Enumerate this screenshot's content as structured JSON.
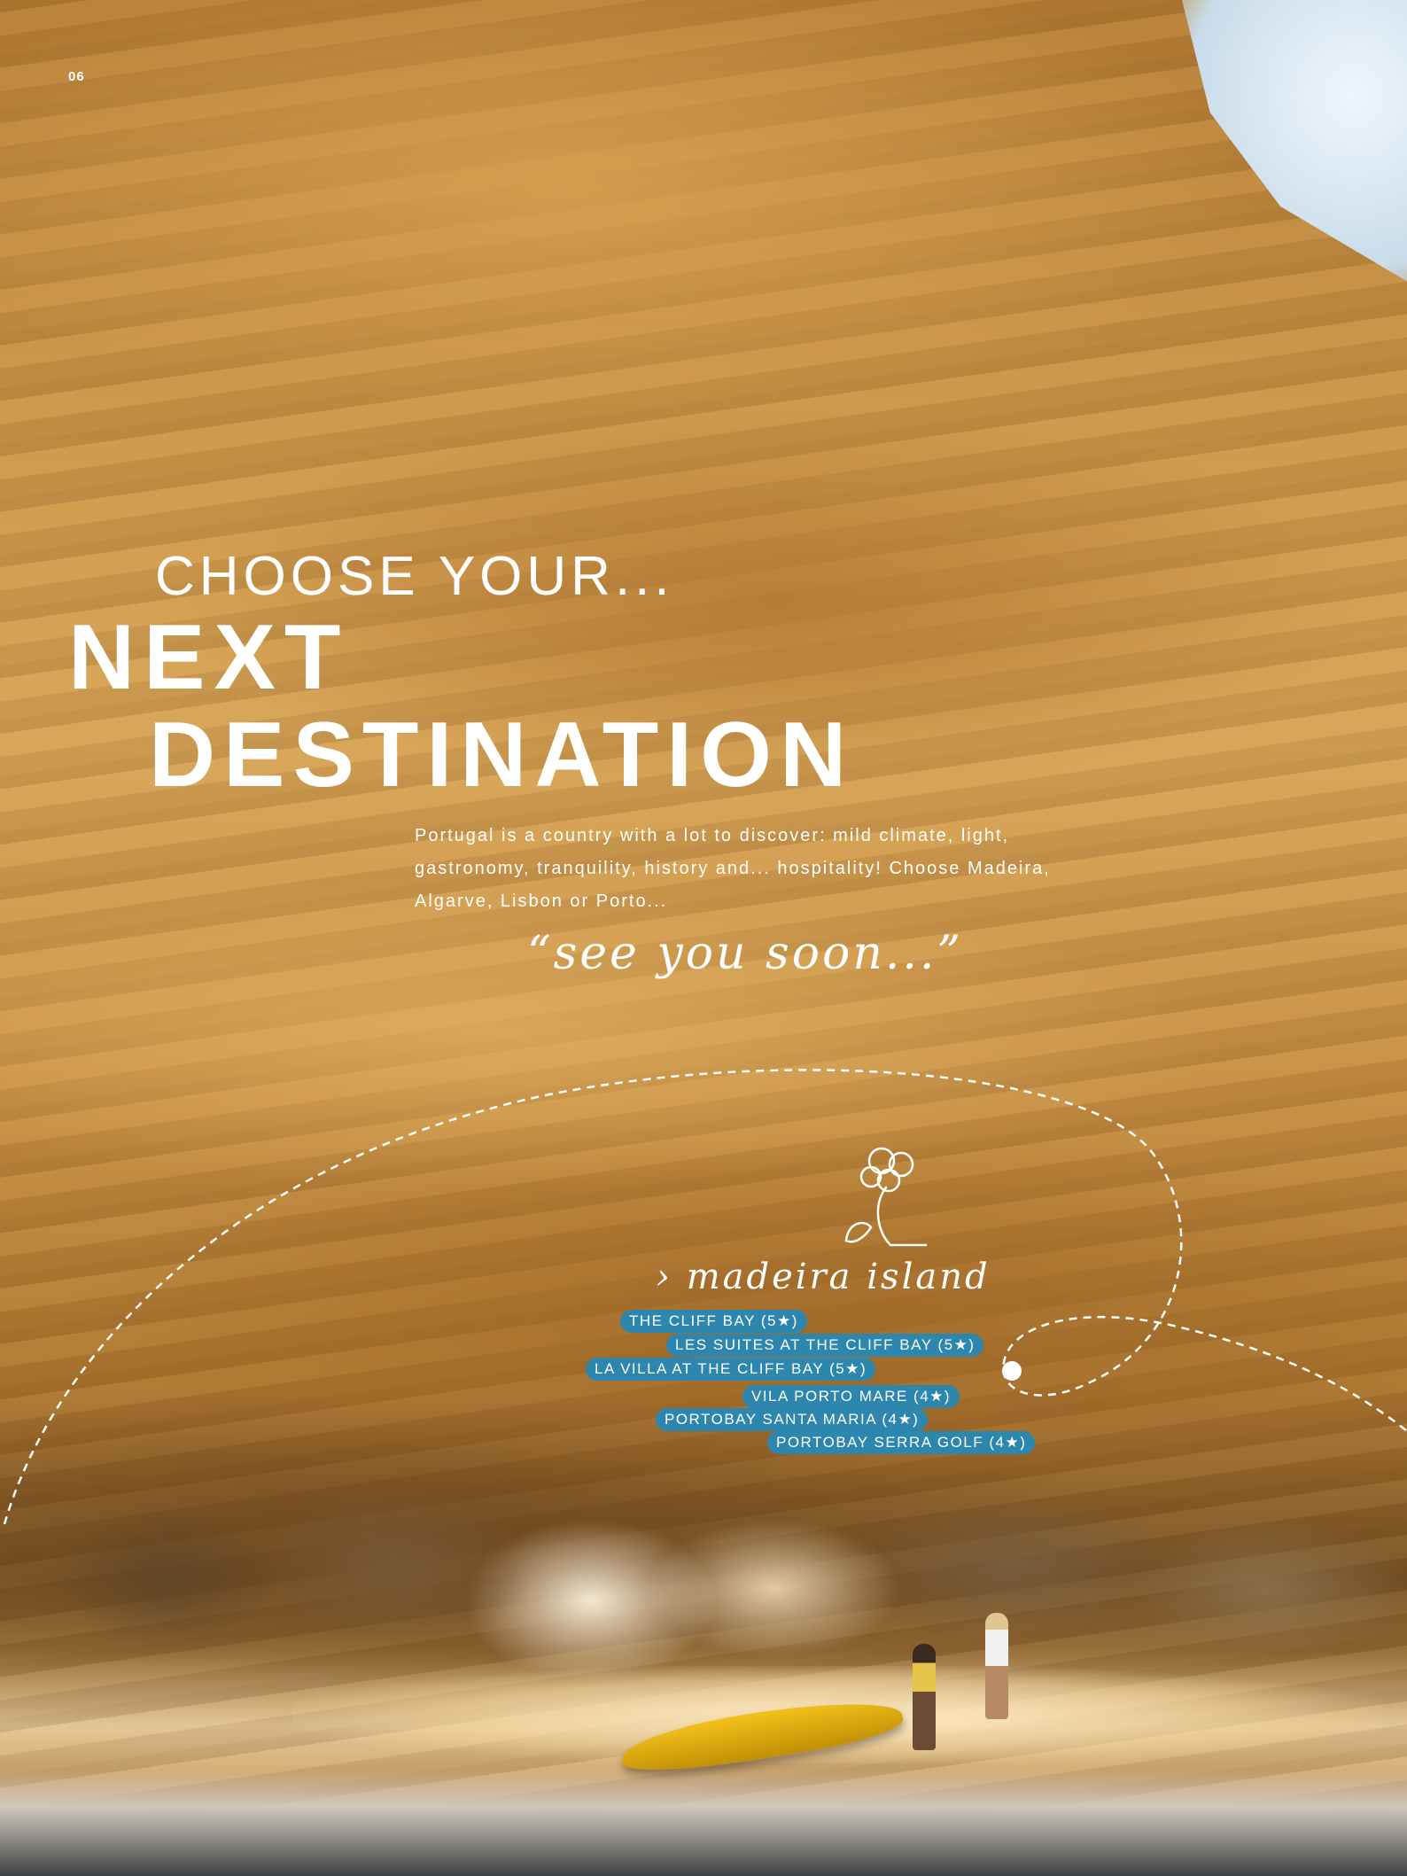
{
  "page_number": "06",
  "headline": {
    "line1": "CHOOSE YOUR...",
    "line2": "NEXT",
    "line3": "DESTINATION"
  },
  "intro_text": "Portugal is a country with a lot to discover: mild climate, light, gastronomy, tranquility, history and... hospitality! Choose Madeira, Algarve, Lisbon or Porto...",
  "tagline": "“see you soon...”",
  "region": {
    "label": "› madeira island",
    "icon": "tree-icon"
  },
  "hotels": [
    "THE CLIFF BAY (5★)",
    "LES SUITES AT THE CLIFF BAY (5★)",
    "LA VILLA AT THE CLIFF BAY (5★)",
    "VILA PORTO MARE (4★)",
    "PORTOBAY SANTA MARIA (4★)",
    "PORTOBAY SERRA GOLF (4★)"
  ],
  "colors": {
    "hotel_badge": "#2d86ad",
    "text": "#ffffff"
  }
}
